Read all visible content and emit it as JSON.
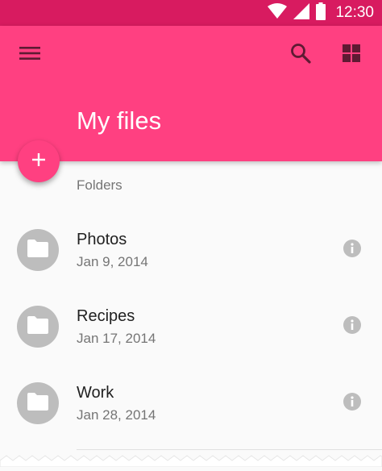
{
  "status_bar": {
    "time": "12:30",
    "background": "#d81b60",
    "icons": [
      "wifi-icon",
      "signal-icon",
      "battery-icon"
    ]
  },
  "app_bar": {
    "title": "My files",
    "background": "#ff4081",
    "icons": [
      "menu-icon",
      "search-icon",
      "grid-view-icon"
    ]
  },
  "fab": {
    "icon": "add-icon"
  },
  "folders": {
    "header": "Folders",
    "items": [
      {
        "name": "Photos",
        "date": "Jan 9, 2014",
        "icon": "folder-icon",
        "action_icon": "info-icon"
      },
      {
        "name": "Recipes",
        "date": "Jan 17, 2014",
        "icon": "folder-icon",
        "action_icon": "info-icon"
      },
      {
        "name": "Work",
        "date": "Jan 28, 2014",
        "icon": "folder-icon",
        "action_icon": "info-icon"
      }
    ]
  },
  "colors": {
    "accent": "#ff4081",
    "primary_dark": "#d81b60",
    "avatar_grey": "#bdbdbd",
    "secondary_text": "#757575",
    "primary_text": "#212121"
  }
}
